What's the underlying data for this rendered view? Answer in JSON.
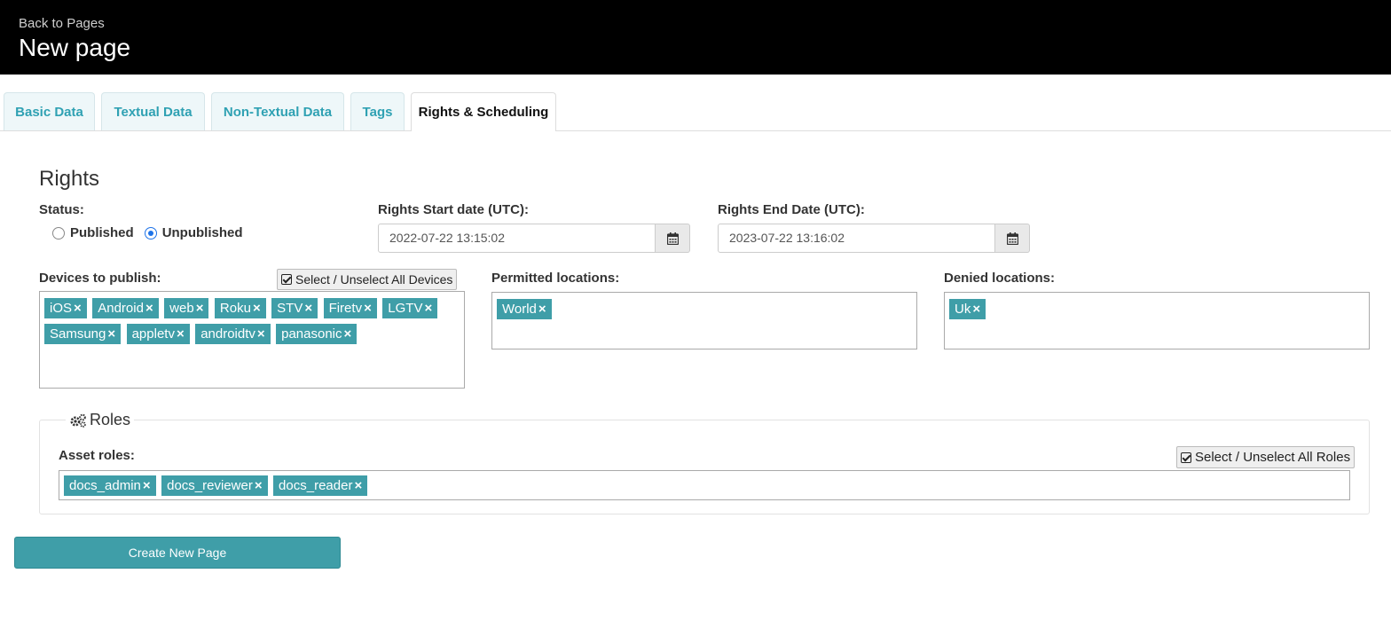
{
  "header": {
    "back_link": "Back to Pages",
    "title": "New page"
  },
  "tabs": [
    {
      "label": "Basic Data",
      "active": false
    },
    {
      "label": "Textual Data",
      "active": false
    },
    {
      "label": "Non-Textual Data",
      "active": false
    },
    {
      "label": "Tags",
      "active": false
    },
    {
      "label": "Rights & Scheduling",
      "active": true
    }
  ],
  "rights": {
    "heading": "Rights",
    "status_label": "Status:",
    "status_options": [
      "Published",
      "Unpublished"
    ],
    "status_selected": "Unpublished",
    "start_label": "Rights Start date (UTC):",
    "start_value": "2022-07-22 13:15:02",
    "end_label": "Rights End Date (UTC):",
    "end_value": "2023-07-22 13:16:02",
    "devices_label": "Devices to publish:",
    "select_all_devices": "Select / Unselect All Devices",
    "devices": [
      "iOS",
      "Android",
      "web",
      "Roku",
      "STV",
      "Firetv",
      "LGTV",
      "Samsung",
      "appletv",
      "androidtv",
      "panasonic"
    ],
    "permitted_label": "Permitted locations:",
    "permitted": [
      "World"
    ],
    "denied_label": "Denied locations:",
    "denied": [
      "Uk"
    ]
  },
  "roles": {
    "heading": "Roles",
    "asset_roles_label": "Asset roles:",
    "select_all_roles": "Select / Unselect All Roles",
    "items": [
      "docs_admin",
      "docs_reviewer",
      "docs_reader"
    ]
  },
  "create_button": "Create New Page",
  "colors": {
    "accent": "#3f9ea8",
    "tab_text": "#2fa1b3",
    "header_bg": "#000000",
    "radio_selected": "#1e73e8"
  },
  "icons": {
    "calendar": "calendar-icon",
    "checkbox": "checkbox-icon",
    "roles": "gears-icon",
    "remove": "remove-icon"
  }
}
